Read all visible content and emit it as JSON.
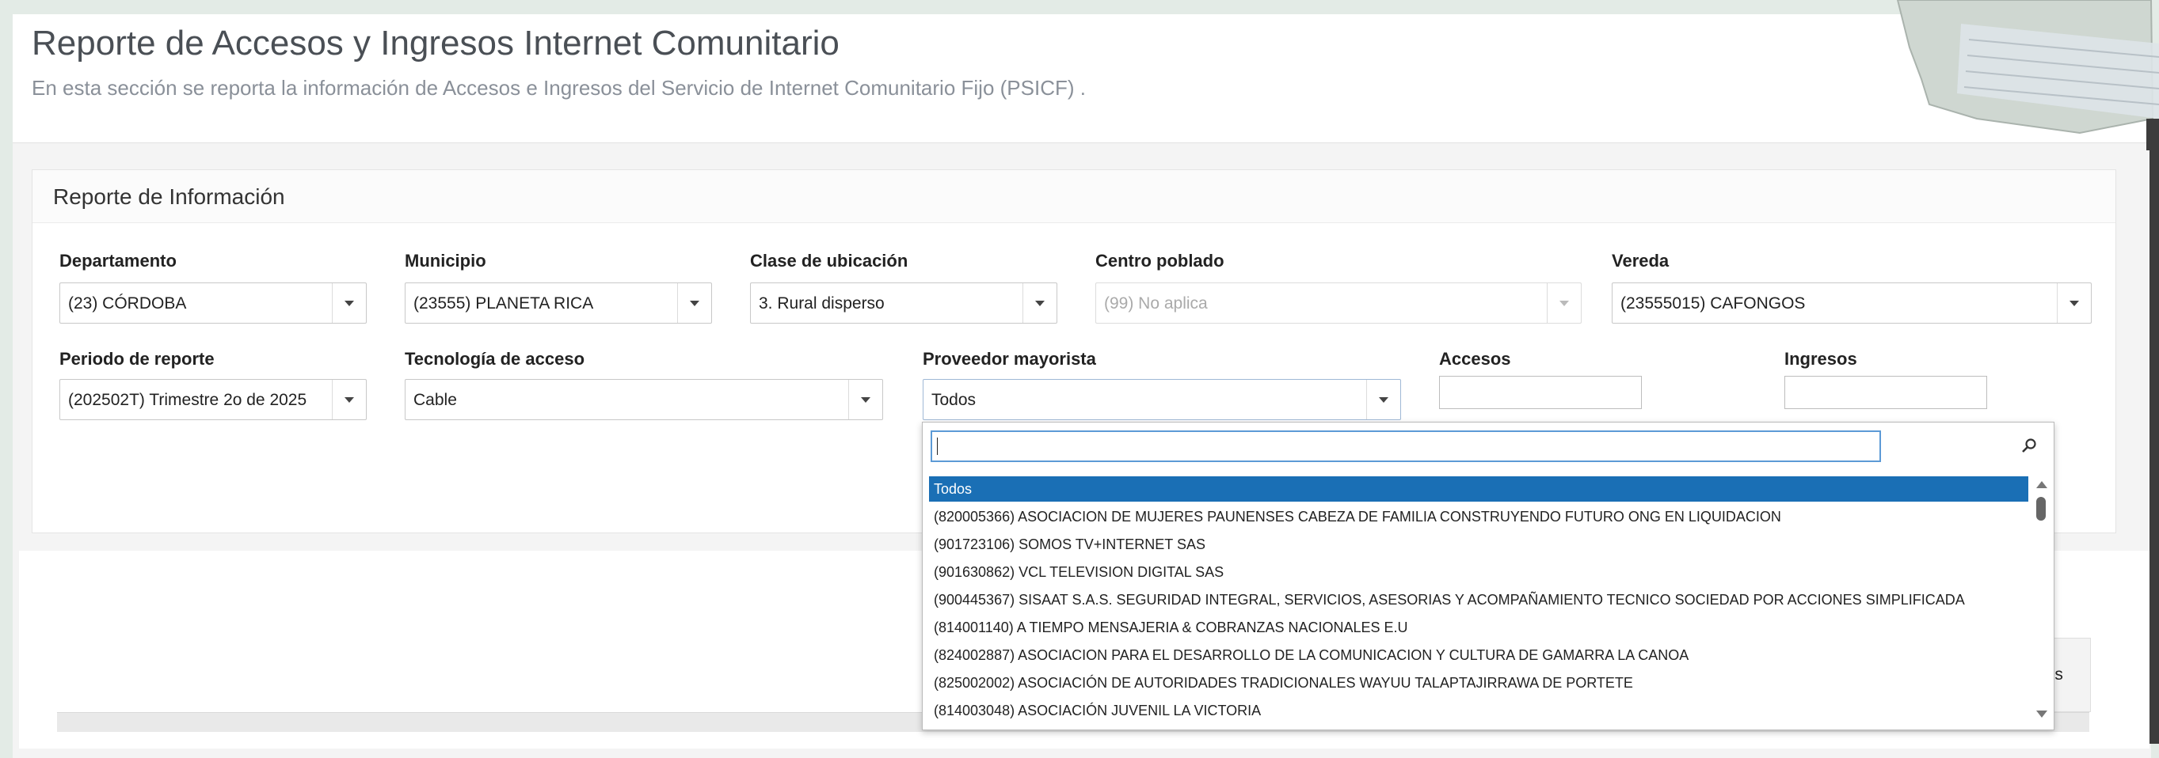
{
  "header": {
    "title": "Reporte de Accesos y Ingresos Internet Comunitario",
    "subtitle": "En esta sección se reporta la información de Accesos e Ingresos del Servicio de Internet Comunitario Fijo (PSICF) ."
  },
  "panel": {
    "title": "Reporte de Información",
    "departamento": {
      "label": "Departamento",
      "value": "(23) CÓRDOBA"
    },
    "municipio": {
      "label": "Municipio",
      "value": "(23555) PLANETA RICA"
    },
    "clase_ubicacion": {
      "label": "Clase de ubicación",
      "value": "3. Rural disperso"
    },
    "centro_poblado": {
      "label": "Centro poblado",
      "value": "(99) No aplica"
    },
    "vereda": {
      "label": "Vereda",
      "value": "(23555015) CAFONGOS"
    },
    "periodo": {
      "label": "Periodo de reporte",
      "value": "(202502T) Trimestre 2o de 2025"
    },
    "tecnologia": {
      "label": "Tecnología de acceso",
      "value": "Cable"
    },
    "proveedor": {
      "label": "Proveedor mayorista",
      "value": "Todos"
    },
    "accesos": {
      "label": "Accesos",
      "value": ""
    },
    "ingresos": {
      "label": "Ingresos",
      "value": ""
    }
  },
  "dropdown": {
    "search_value": "",
    "items": [
      "Todos",
      "(820005366) ASOCIACION DE MUJERES PAUNENSES CABEZA DE FAMILIA CONSTRUYENDO FUTURO ONG EN LIQUIDACION",
      "(901723106) SOMOS TV+INTERNET SAS",
      "(901630862) VCL TELEVISION DIGITAL SAS",
      "(900445367) SISAAT S.A.S. SEGURIDAD INTEGRAL, SERVICIOS, ASESORIAS Y ACOMPAÑAMIENTO TECNICO SOCIEDAD POR ACCIONES SIMPLIFICADA",
      "(814001140) A TIEMPO MENSAJERIA & COBRANZAS NACIONALES E.U",
      "(824002887) ASOCIACION PARA EL DESARROLLO DE LA COMUNICACION Y CULTURA DE GAMARRA LA CANOA",
      "(825002002) ASOCIACIÓN DE AUTORIDADES TRADICIONALES WAYUU TALAPTAJIRRAWA DE PORTETE",
      "(814003048) ASOCIACIÓN JUVENIL LA VICTORIA"
    ]
  },
  "table": {
    "partial_header": "nes"
  },
  "colors": {
    "selected_item": "#1a6fb5",
    "search_focus": "#5c9ad6"
  }
}
